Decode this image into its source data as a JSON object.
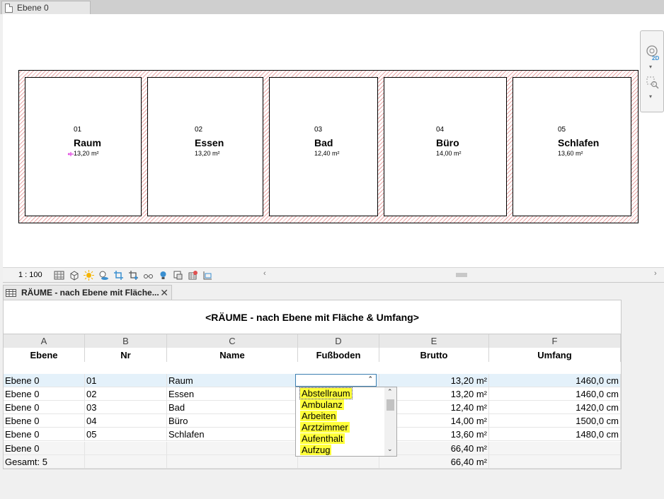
{
  "view_tab": {
    "title": "Ebene 0"
  },
  "plan": {
    "rooms": [
      {
        "number": "01",
        "name": "Raum",
        "area": "13,20 m²"
      },
      {
        "number": "02",
        "name": "Essen",
        "area": "13,20 m²"
      },
      {
        "number": "03",
        "name": "Bad",
        "area": "12,40 m²"
      },
      {
        "number": "04",
        "name": "Büro",
        "area": "14,00 m²"
      },
      {
        "number": "05",
        "name": "Schlafen",
        "area": "13,60 m²"
      }
    ]
  },
  "nav_bar": {
    "mode_label": "2D"
  },
  "view_control": {
    "scale": "1 : 100"
  },
  "schedule_tab": {
    "title": "RÄUME - nach Ebene mit Fläche..."
  },
  "schedule": {
    "title": "<RÄUME - nach Ebene mit Fläche & Umfang>",
    "column_letters": [
      "A",
      "B",
      "C",
      "D",
      "E",
      "F"
    ],
    "column_headers": [
      "Ebene",
      "Nr",
      "Name",
      "Fußboden",
      "Brutto",
      "Umfang"
    ],
    "rows": [
      {
        "ebene": "Ebene 0",
        "nr": "01",
        "name": "Raum",
        "boden": "",
        "brutto": "13,20 m²",
        "umfang": "1460,0 cm"
      },
      {
        "ebene": "Ebene 0",
        "nr": "02",
        "name": "Essen",
        "boden": "",
        "brutto": "13,20 m²",
        "umfang": "1460,0 cm"
      },
      {
        "ebene": "Ebene 0",
        "nr": "03",
        "name": "Bad",
        "boden": "",
        "brutto": "12,40 m²",
        "umfang": "1420,0 cm"
      },
      {
        "ebene": "Ebene 0",
        "nr": "04",
        "name": "Büro",
        "boden": "",
        "brutto": "14,00 m²",
        "umfang": "1500,0 cm"
      },
      {
        "ebene": "Ebene 0",
        "nr": "05",
        "name": "Schlafen",
        "boden": "",
        "brutto": "13,60 m²",
        "umfang": "1480,0 cm"
      }
    ],
    "subtotal": {
      "label": "Ebene 0",
      "brutto": "66,40 m²"
    },
    "grand_total": {
      "label": "Gesamt: 5",
      "brutto": "66,40 m²"
    }
  },
  "dropdown": {
    "value": "",
    "options": [
      "Abstellraum",
      "Ambulanz",
      "Arbeiten",
      "Arztzimmer",
      "Aufenthalt",
      "Aufzug"
    ]
  },
  "colors": {
    "highlight": "#ffff3a",
    "selected_row": "#e4f1fa",
    "wall_hatch": "#e8a5a5"
  },
  "icons": [
    "document-icon",
    "viewcube-icon",
    "zoom-icon",
    "table-icon",
    "close-icon"
  ]
}
